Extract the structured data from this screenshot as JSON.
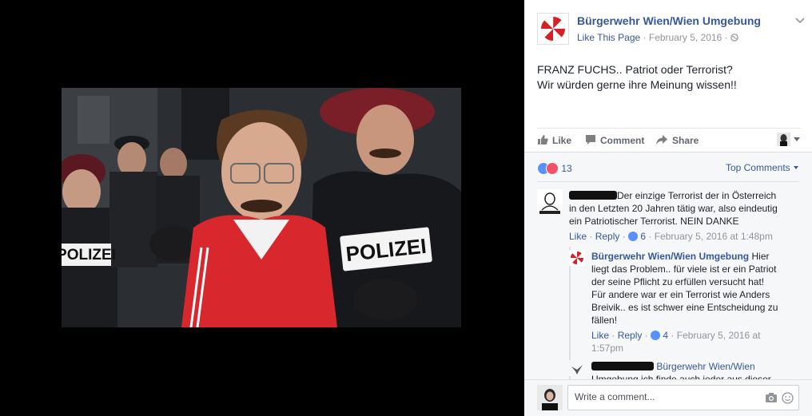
{
  "post": {
    "page_name": "Bürgerwehr Wien/Wien Umgebung",
    "like_page": "Like This Page",
    "date": "February 5, 2016",
    "separator": "·",
    "text_line1": "FRANZ FUCHS.. Patriot oder Terrorist?",
    "text_line2": "Wir würden gerne ihre Meinung wissen!!"
  },
  "photo": {
    "vest_label": "POLIZEI"
  },
  "actions": {
    "like": "Like",
    "comment": "Comment",
    "share": "Share"
  },
  "reactions": {
    "count": "13",
    "top_comments": "Top Comments"
  },
  "comments": [
    {
      "line1": "Der einzige Terrorist der in Österreich",
      "line2": "in den Letzten 20 Jahren tätig war, also eindeutig",
      "line3": "ein Patriotischer Terrorist. NEIN DANKE",
      "like": "Like",
      "reply": "Reply",
      "likes": "6",
      "time": "February 5, 2016 at 1:48pm"
    },
    {
      "author": "Bürgerwehr Wien/Wien Umgebung",
      "line1": "Hier",
      "line2": "liegt das Problem.. für viele ist er ein Patriot",
      "line3": "der seine Pflicht zu erfüllen versucht hat!",
      "line4": "Für andere war er ein Terrorist wie Anders",
      "line5": "Breivik.. es ist schwer eine Entscheidung zu",
      "line6": "fällen!",
      "like": "Like",
      "reply": "Reply",
      "likes": "4",
      "time1": "February 5, 2016 at",
      "time2": "1:57pm"
    },
    {
      "mention": "Bürgerwehr Wien/Wien",
      "line2": "Umgebung ich finde auch jeder aus dieser"
    }
  ],
  "composer": {
    "placeholder": "Write a comment..."
  },
  "colors": {
    "link": "#365899",
    "text": "#1d2129",
    "meta": "#90949c",
    "like_blue": "#5890ff",
    "love_red": "#f25268"
  },
  "icons": [
    "umbrella-logo-icon",
    "chevron-down-icon",
    "globe-icon",
    "thumbs-up-icon",
    "comment-icon",
    "share-icon",
    "camera-icon",
    "emoji-icon"
  ]
}
